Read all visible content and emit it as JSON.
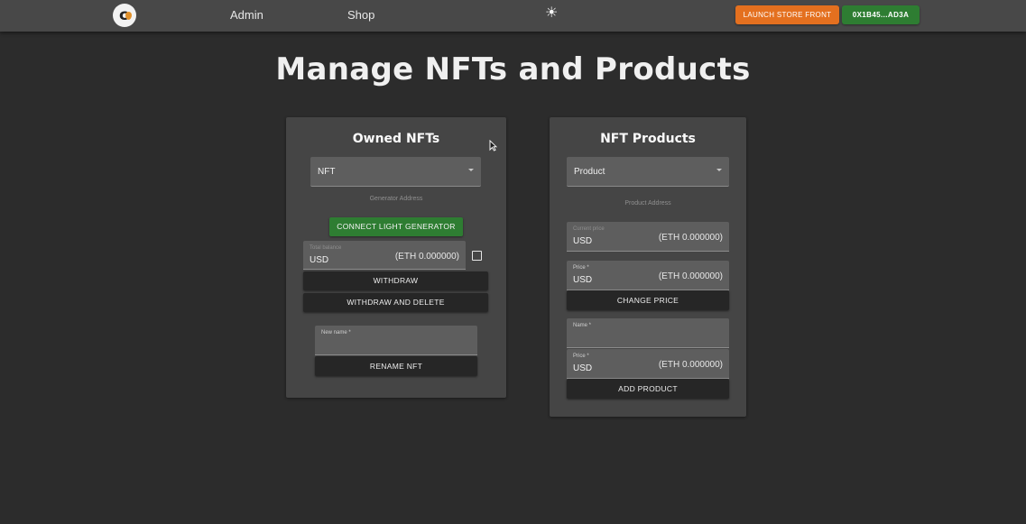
{
  "nav": {
    "links": [
      "Admin",
      "Shop"
    ],
    "theme_icon": "sun-icon",
    "launch_label": "LAUNCH STORE FRONT",
    "wallet_label": "0X1B45...AD3A",
    "colors": {
      "launch": "#e4701f",
      "wallet": "#2e7d32"
    }
  },
  "page": {
    "title": "Manage NFTs and Products"
  },
  "owned": {
    "title": "Owned NFTs",
    "select_value": "NFT",
    "helper": "Generator Address",
    "connect_label": "CONNECT LIGHT GENERATOR",
    "balance": {
      "label": "Total balance",
      "currency": "USD",
      "eth": "(ETH 0.000000)"
    },
    "withdraw_label": "WITHDRAW",
    "withdraw_delete_label": "WITHDRAW AND DELETE",
    "new_name_label": "New name *",
    "rename_label": "RENAME NFT"
  },
  "products": {
    "title": "NFT Products",
    "select_value": "Product",
    "helper": "Product Address",
    "current_price": {
      "label": "Current price",
      "currency": "USD",
      "eth": "(ETH 0.000000)"
    },
    "price": {
      "label": "Price *",
      "currency": "USD",
      "eth": "(ETH 0.000000)"
    },
    "change_price_label": "CHANGE PRICE",
    "name_label": "Name *",
    "new_price": {
      "label": "Price *",
      "currency": "USD",
      "eth": "(ETH 0.000000)"
    },
    "add_label": "ADD PRODUCT"
  }
}
